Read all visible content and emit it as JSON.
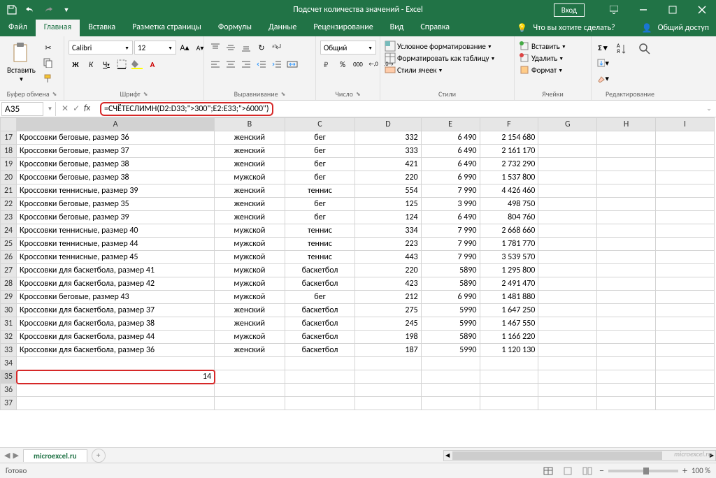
{
  "title": "Подсчет количества значений  -  Excel",
  "login": "Вход",
  "tabs": {
    "file": "Файл",
    "home": "Главная",
    "insert": "Вставка",
    "layout": "Разметка страницы",
    "formulas": "Формулы",
    "data": "Данные",
    "review": "Рецензирование",
    "view": "Вид",
    "help": "Справка",
    "tellme": "Что вы хотите сделать?",
    "share": "Общий доступ"
  },
  "ribbon": {
    "clipboard": {
      "paste": "Вставить",
      "label": "Буфер обмена"
    },
    "font": {
      "name": "Calibri",
      "size": "12",
      "label": "Шрифт",
      "bold": "Ж",
      "italic": "К",
      "underline": "Ч"
    },
    "align": {
      "label": "Выравнивание"
    },
    "number": {
      "combo": "Общий",
      "label": "Число"
    },
    "styles": {
      "cond": "Условное форматирование",
      "table": "Форматировать как таблицу",
      "cell": "Стили ячеек",
      "label": "Стили"
    },
    "cells": {
      "insert": "Вставить",
      "delete": "Удалить",
      "format": "Формат",
      "label": "Ячейки"
    },
    "editing": {
      "label": "Редактирование"
    }
  },
  "namebox": "A35",
  "formula": "=СЧЁТЕСЛИМН(D2:D33;\">300\";E2:E33;\">6000\")",
  "cols": [
    "A",
    "B",
    "C",
    "D",
    "E",
    "F",
    "G",
    "H",
    "I"
  ],
  "rows": [
    {
      "n": 17,
      "a": "Кроссовки беговые, размер 36",
      "b": "женский",
      "c": "бег",
      "d": "332",
      "e": "6 490",
      "f": "2 154 680"
    },
    {
      "n": 18,
      "a": "Кроссовки беговые, размер 37",
      "b": "женский",
      "c": "бег",
      "d": "333",
      "e": "6 490",
      "f": "2 161 170"
    },
    {
      "n": 19,
      "a": "Кроссовки беговые, размер 38",
      "b": "женский",
      "c": "бег",
      "d": "421",
      "e": "6 490",
      "f": "2 732 290"
    },
    {
      "n": 20,
      "a": "Кроссовки беговые, размер 38",
      "b": "мужской",
      "c": "бег",
      "d": "220",
      "e": "6 990",
      "f": "1 537 800"
    },
    {
      "n": 21,
      "a": "Кроссовки теннисные, размер 39",
      "b": "женский",
      "c": "теннис",
      "d": "554",
      "e": "7 990",
      "f": "4 426 460"
    },
    {
      "n": 22,
      "a": "Кроссовки беговые, размер 35",
      "b": "женский",
      "c": "бег",
      "d": "125",
      "e": "3 990",
      "f": "498 750"
    },
    {
      "n": 23,
      "a": "Кроссовки беговые, размер 39",
      "b": "женский",
      "c": "бег",
      "d": "124",
      "e": "6 490",
      "f": "804 760"
    },
    {
      "n": 24,
      "a": "Кроссовки теннисные, размер 40",
      "b": "мужской",
      "c": "теннис",
      "d": "334",
      "e": "7 990",
      "f": "2 668 660"
    },
    {
      "n": 25,
      "a": "Кроссовки теннисные, размер 44",
      "b": "мужской",
      "c": "теннис",
      "d": "223",
      "e": "7 990",
      "f": "1 781 770"
    },
    {
      "n": 26,
      "a": "Кроссовки теннисные, размер 45",
      "b": "мужской",
      "c": "теннис",
      "d": "443",
      "e": "7 990",
      "f": "3 539 570"
    },
    {
      "n": 27,
      "a": "Кроссовки для баскетбола, размер 41",
      "b": "мужской",
      "c": "баскетбол",
      "d": "220",
      "e": "5890",
      "f": "1 295 800"
    },
    {
      "n": 28,
      "a": "Кроссовки для баскетбола, размер 42",
      "b": "мужской",
      "c": "баскетбол",
      "d": "423",
      "e": "5890",
      "f": "2 491 470"
    },
    {
      "n": 29,
      "a": "Кроссовки беговые, размер 43",
      "b": "мужской",
      "c": "бег",
      "d": "212",
      "e": "6 990",
      "f": "1 481 880"
    },
    {
      "n": 30,
      "a": "Кроссовки для баскетбола, размер 37",
      "b": "женский",
      "c": "баскетбол",
      "d": "275",
      "e": "5990",
      "f": "1 647 250"
    },
    {
      "n": 31,
      "a": "Кроссовки для баскетбола, размер 38",
      "b": "женский",
      "c": "баскетбол",
      "d": "245",
      "e": "5990",
      "f": "1 467 550"
    },
    {
      "n": 32,
      "a": "Кроссовки для баскетбола, размер 44",
      "b": "мужской",
      "c": "баскетбол",
      "d": "198",
      "e": "5890",
      "f": "1 166 220"
    },
    {
      "n": 33,
      "a": "Кроссовки для баскетбола, размер 36",
      "b": "женский",
      "c": "баскетбол",
      "d": "187",
      "e": "5990",
      "f": "1 120 130"
    }
  ],
  "result_row": 35,
  "result_value": "14",
  "empty_rows": [
    34,
    36,
    37
  ],
  "sheet_tab": "microexcel.ru",
  "status": "Готово",
  "zoom": "100 %",
  "watermark": "microexcel.ru"
}
